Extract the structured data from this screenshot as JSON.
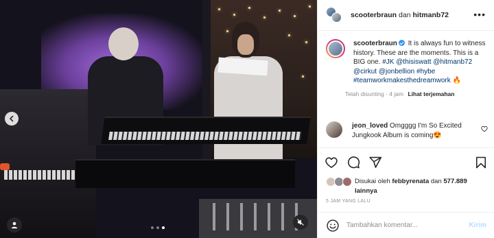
{
  "header": {
    "user1": "scooterbraun",
    "separator": "dan",
    "user2": "hitmanb72",
    "more_icon": "more-horizontal-icon"
  },
  "caption": {
    "username": "scooterbraun",
    "verified": true,
    "text": "It is always fun to witness history. These are the moments. This is a BIG one.",
    "tags": [
      "#JK",
      "@thisiswatt",
      "@hitmanb72",
      "@cirkut",
      "@jonbellion",
      "#hybe",
      "#teamworkmakesthedreamwork"
    ],
    "emoji": "🔥",
    "edited_label": "Telah disunting",
    "time": "4 jam",
    "translate_label": "Lihat terjemahan"
  },
  "comment": {
    "username": "jeon_loved",
    "text": "Omgggg I'm So Excited Jungkook Album is coming",
    "emoji": "😍"
  },
  "likes": {
    "prefix": "Disukai oleh",
    "user": "febbyrenata",
    "mid": "dan",
    "count": "577.889",
    "suffix": "lainnya"
  },
  "timestamp": "5 JAM YANG LALU",
  "add_comment": {
    "placeholder": "Tambahkan komentar...",
    "post_label": "Kirim"
  },
  "media": {
    "carousel_total": 3,
    "carousel_active": 3
  },
  "colors": {
    "link": "#00376b",
    "muted": "#8e8e8e",
    "verified": "#3897f0",
    "post_disabled": "#b2dffc"
  }
}
